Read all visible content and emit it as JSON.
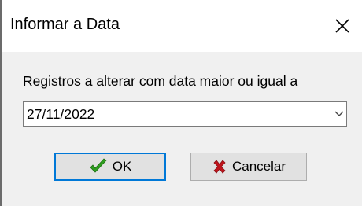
{
  "window": {
    "title": "Informar a Data",
    "close_icon": "close-icon"
  },
  "form": {
    "prompt": "Registros a alterar com data maior ou igual a",
    "date_value": "27/11/2022",
    "dropdown_icon": "chevron-down-icon"
  },
  "buttons": {
    "ok_label": "OK",
    "ok_icon": "checkmark-icon",
    "ok_icon_color": "#2e9e1f",
    "cancel_label": "Cancelar",
    "cancel_icon": "x-icon",
    "cancel_icon_color": "#c0141c"
  },
  "colors": {
    "focus_border": "#0078d7",
    "dialog_background": "#f0f0f0"
  }
}
